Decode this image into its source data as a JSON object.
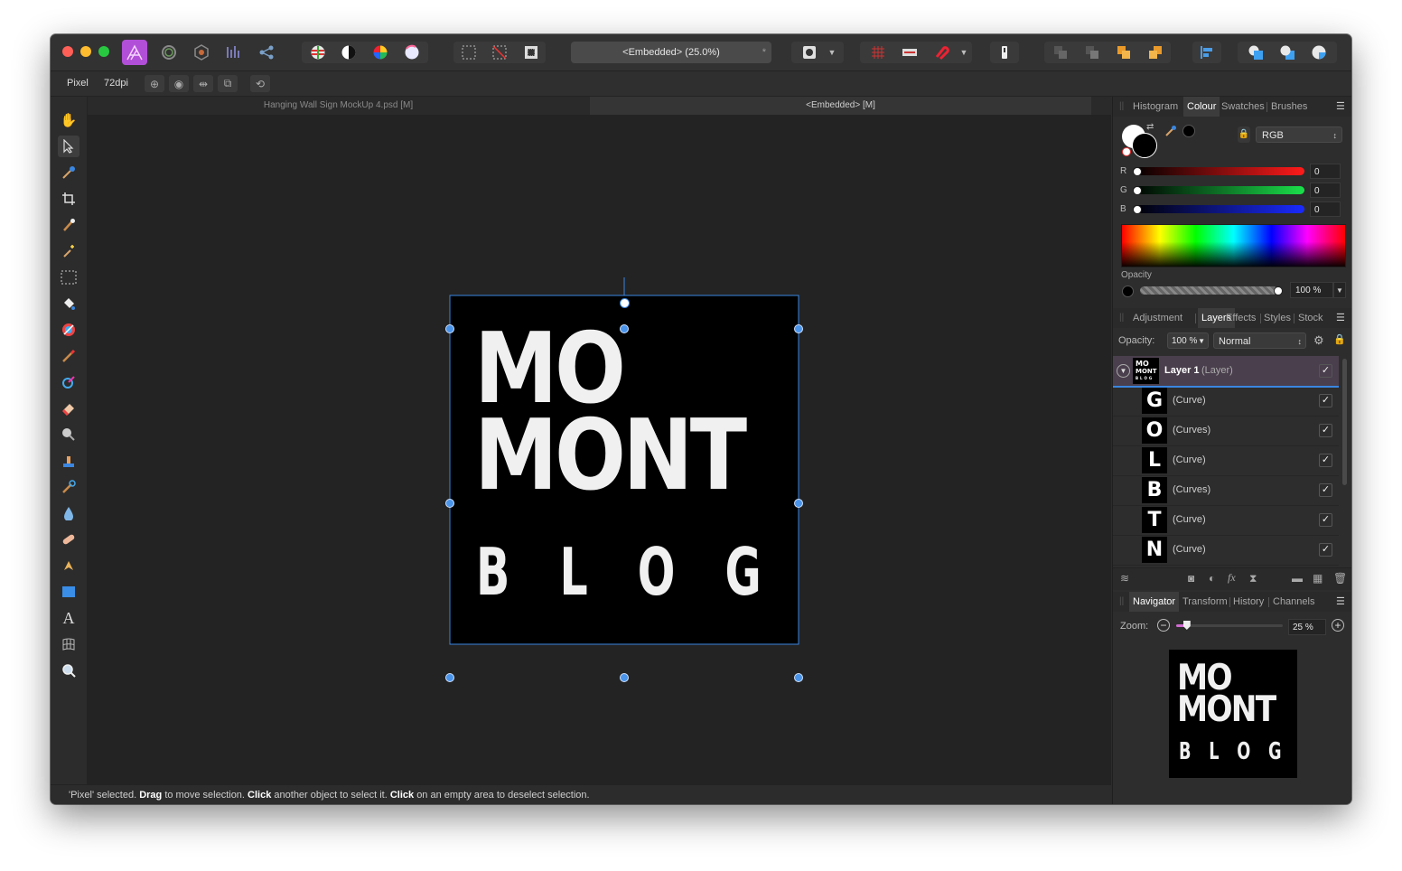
{
  "toolbar": {
    "document_title": "<Embedded> (25.0%)",
    "star_label": "*"
  },
  "context": {
    "tool_name": "Pixel",
    "dpi": "72dpi"
  },
  "doc_tabs": [
    {
      "label": "Hanging Wall Sign MockUp 4.psd [M]"
    },
    {
      "label": "<Embedded> [M]"
    }
  ],
  "artwork": {
    "line1": "MO",
    "line2": "MONT",
    "line3": "B L O G"
  },
  "status": {
    "quote": "'Pixel' selected.",
    "drag": "Drag",
    "drag_text": "to move selection.",
    "click": "Click",
    "click_text": "another object to select it.",
    "click2": "Click",
    "click2_text": "on an empty area to deselect selection."
  },
  "colour_panel": {
    "tabs": [
      "Histogram",
      "Colour",
      "Swatches",
      "Brushes"
    ],
    "active_tab": "Colour",
    "mode": "RGB",
    "channels": [
      {
        "label": "R",
        "value": "0"
      },
      {
        "label": "G",
        "value": "0"
      },
      {
        "label": "B",
        "value": "0"
      }
    ],
    "opacity_label": "Opacity",
    "opacity_value": "100 %"
  },
  "layers_panel": {
    "tabs": [
      "Adjustment",
      "Layers",
      "Effects",
      "Styles",
      "Stock"
    ],
    "active_tab": "Layers",
    "opacity_label": "Opacity:",
    "opacity_value": "100 %",
    "blend_mode": "Normal",
    "parent": {
      "name": "Layer 1",
      "type": "(Layer)",
      "thumb_text": [
        "MO",
        "MONT",
        "BLOG"
      ]
    },
    "children": [
      {
        "glyph": "G",
        "name": "(Curve)"
      },
      {
        "glyph": "O",
        "name": "(Curves)"
      },
      {
        "glyph": "L",
        "name": "(Curve)"
      },
      {
        "glyph": "B",
        "name": "(Curves)"
      },
      {
        "glyph": "T",
        "name": "(Curve)"
      },
      {
        "glyph": "N",
        "name": "(Curve)"
      }
    ]
  },
  "navigator_panel": {
    "tabs": [
      "Navigator",
      "Transform",
      "History",
      "Channels"
    ],
    "active_tab": "Navigator",
    "zoom_label": "Zoom:",
    "zoom_value": "25 %",
    "zoom_fraction": 0.1,
    "preview": {
      "line1": "MO",
      "line2": "MONT",
      "line3": "B L O G"
    }
  },
  "colors": {
    "accent": "#2e7bd6",
    "canvas_bg": "#232323",
    "panel_bg": "#2d2d2d",
    "selection_handle": "#3a86e0",
    "layer_selected": "#4a3f4d"
  }
}
